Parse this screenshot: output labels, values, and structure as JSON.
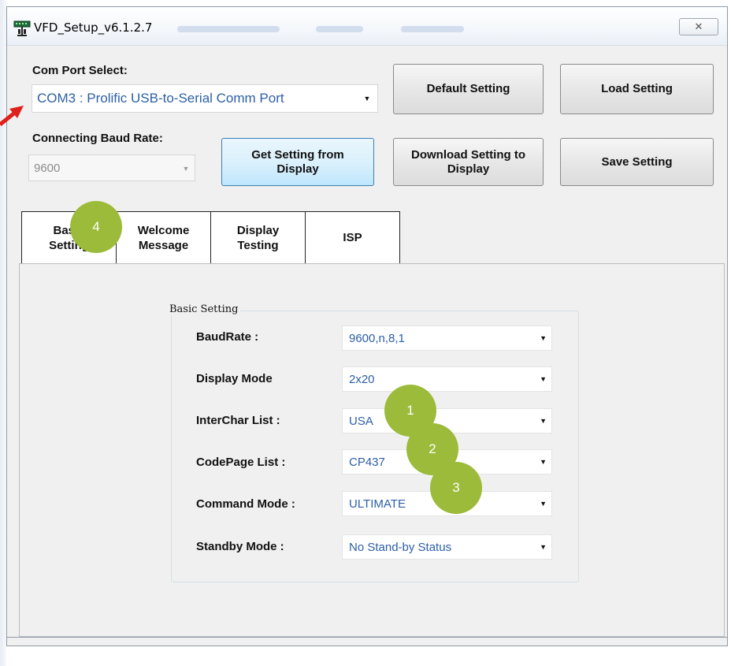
{
  "window": {
    "title": "VFD_Setup_v6.1.2.7",
    "close_glyph": "✕"
  },
  "com_port": {
    "label": "Com Port Select:",
    "value": "COM3 : Prolific USB-to-Serial Comm Port"
  },
  "baud": {
    "label": "Connecting Baud Rate:",
    "value": "9600"
  },
  "buttons": {
    "default_setting": "Default Setting",
    "load_setting": "Load Setting",
    "get_setting_line1": "Get Setting from",
    "get_setting_line2": "Display",
    "download_setting_line1": "Download Setting to",
    "download_setting_line2": "Display",
    "save_setting": "Save Setting"
  },
  "tabs": [
    {
      "line1": "Basic",
      "line2": "Setting"
    },
    {
      "line1": "Welcome",
      "line2": "Message"
    },
    {
      "line1": "Display",
      "line2": "Testing"
    },
    {
      "line1": "ISP",
      "line2": ""
    }
  ],
  "group": {
    "title": "Basic Setting",
    "rows": [
      {
        "label": "BaudRate :",
        "value": "9600,n,8,1"
      },
      {
        "label": "Display Mode",
        "value": "2x20"
      },
      {
        "label": "InterChar  List :",
        "value": "USA"
      },
      {
        "label": "CodePage List :",
        "value": "CP437"
      },
      {
        "label": "Command Mode :",
        "value": "ULTIMATE"
      },
      {
        "label": "Standby Mode :",
        "value": "No Stand-by Status"
      }
    ]
  },
  "callouts": [
    "1",
    "2",
    "3",
    "4"
  ],
  "colors": {
    "callout": "#9cbb3a",
    "arrow": "#e0201b",
    "value_text": "#2d5fa6"
  },
  "icons": {
    "app": "vfd-display-icon",
    "dropdown": "▼"
  }
}
